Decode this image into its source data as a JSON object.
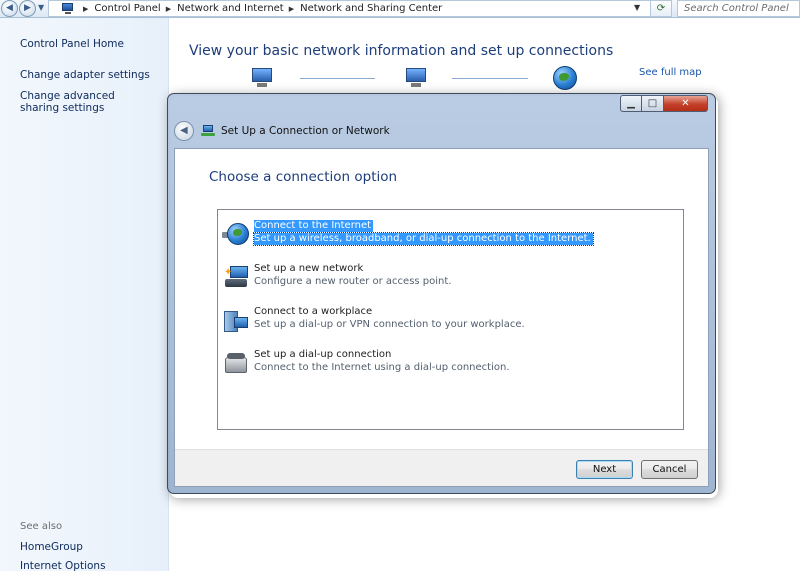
{
  "address_bar": {
    "crumbs": [
      "Control Panel",
      "Network and Internet",
      "Network and Sharing Center"
    ],
    "search_placeholder": "Search Control Panel"
  },
  "left_pane": {
    "links": [
      "Control Panel Home",
      "Change adapter settings",
      "Change advanced sharing settings"
    ],
    "see_also_label": "See also",
    "see_also_links": [
      "HomeGroup",
      "Internet Options"
    ]
  },
  "main": {
    "title": "View your basic network information and set up connections",
    "full_map_link": "See full map"
  },
  "dialog": {
    "title": "Set Up a Connection or Network",
    "heading": "Choose a connection option",
    "options": [
      {
        "title": "Connect to the Internet",
        "desc": "Set up a wireless, broadband, or dial-up connection to the Internet.",
        "icon": "globe-icon",
        "selected": true
      },
      {
        "title": "Set up a new network",
        "desc": "Configure a new router or access point.",
        "icon": "router-icon",
        "selected": false
      },
      {
        "title": "Connect to a workplace",
        "desc": "Set up a dial-up or VPN connection to your workplace.",
        "icon": "workplace-icon",
        "selected": false
      },
      {
        "title": "Set up a dial-up connection",
        "desc": "Connect to the Internet using a dial-up connection.",
        "icon": "phone-icon",
        "selected": false
      }
    ],
    "next_label": "Next",
    "cancel_label": "Cancel"
  },
  "colors": {
    "selection": "#3399ff",
    "heading_blue": "#1e3d7b",
    "link_blue": "#1a55a8"
  }
}
